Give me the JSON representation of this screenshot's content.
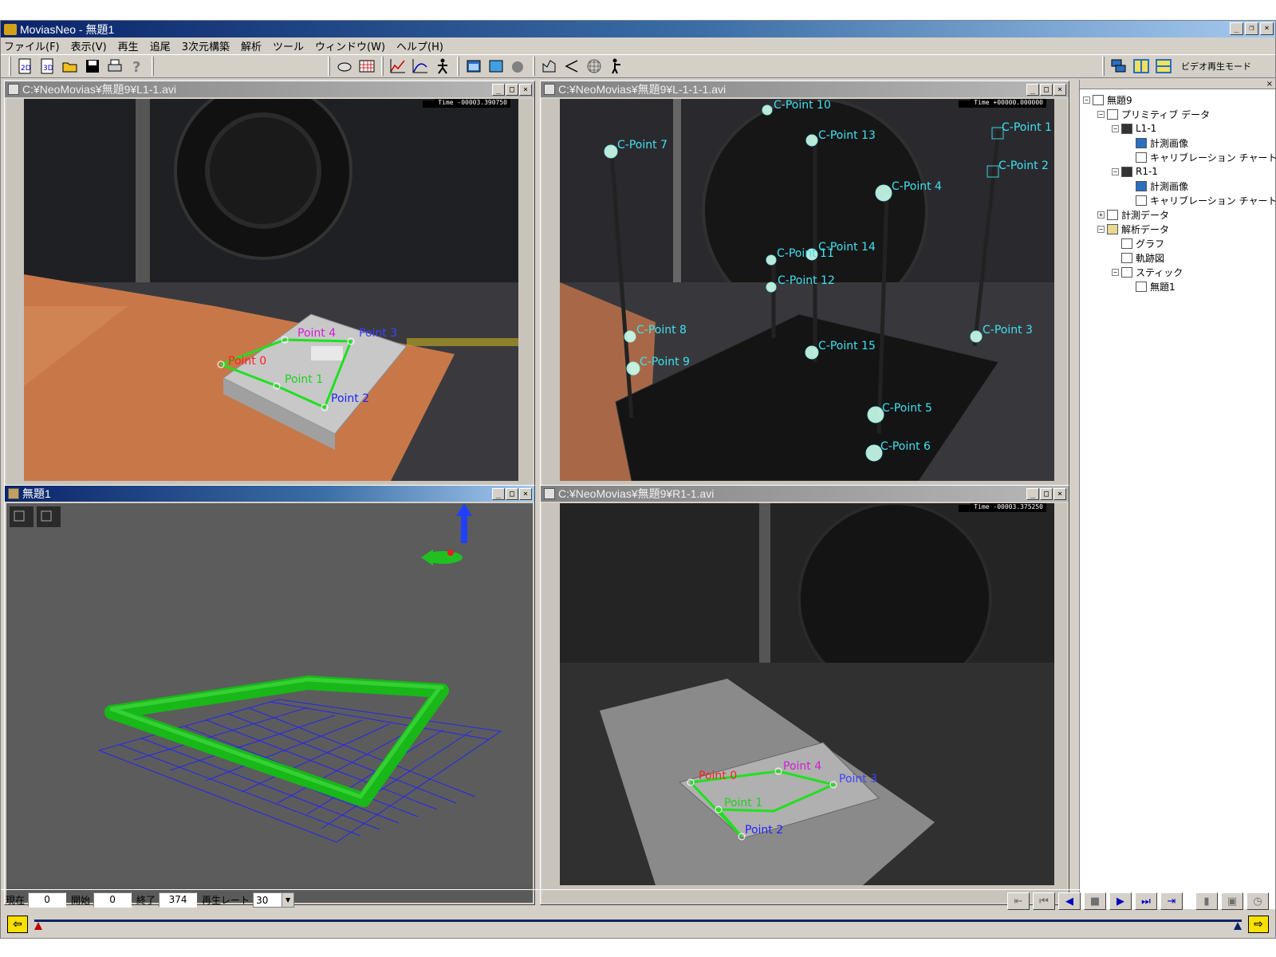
{
  "window": {
    "title": "MoviasNeo - 無題1"
  },
  "menu": [
    "ファイル(F)",
    "表示(V)",
    "再生",
    "追尾",
    "3次元構築",
    "解析",
    "ツール",
    "ウィンドウ(W)",
    "ヘルプ(H)"
  ],
  "toolbar": {
    "mode_label": "ビデオ再生モード",
    "icons": [
      "2d-icon",
      "3d-icon",
      "open-folder-icon",
      "save-icon",
      "print-icon",
      "help-icon",
      "camera-icon",
      "grid-icon",
      "graph-icon",
      "trajectory-icon",
      "stick-figure-icon",
      "window-icon",
      "window-alt-icon",
      "sphere-icon",
      "analysis-icon",
      "link-icon",
      "mesh-icon",
      "person-icon",
      "cascade-icon",
      "tile-vertical-icon",
      "tile-horizontal-icon"
    ]
  },
  "windows": {
    "top_left": {
      "title": "C:¥NeoMovias¥無題9¥L1-1.avi",
      "time": "Time  -00003.390750",
      "points": [
        {
          "label": "Point 0",
          "color": "#ff2020"
        },
        {
          "label": "Point 4",
          "color": "#d020d0"
        },
        {
          "label": "Point 3",
          "color": "#4040ff"
        },
        {
          "label": "Point 1",
          "color": "#20d020"
        },
        {
          "label": "Point 2",
          "color": "#2020ff"
        }
      ]
    },
    "top_right": {
      "title": "C:¥NeoMovias¥無題9¥L-1-1-1.avi",
      "time": "Time  +00000.000000",
      "points": [
        {
          "label": "C-Point 10"
        },
        {
          "label": "C-Point 13"
        },
        {
          "label": "C-Point 7"
        },
        {
          "label": "C-Point 1"
        },
        {
          "label": "C-Point 2"
        },
        {
          "label": "C-Point 4"
        },
        {
          "label": "C-Point 14"
        },
        {
          "label": "C-Point 11"
        },
        {
          "label": "C-Point 12"
        },
        {
          "label": "C-Point 8"
        },
        {
          "label": "C-Point 3"
        },
        {
          "label": "C-Point 15"
        },
        {
          "label": "C-Point 9"
        },
        {
          "label": "C-Point 5"
        },
        {
          "label": "C-Point 6"
        }
      ],
      "label_color": "#40e0f0"
    },
    "bottom_left": {
      "title": "無題1"
    },
    "bottom_right": {
      "title": "C:¥NeoMovias¥無題9¥R1-1.avi",
      "time": "Time  -00003.375250",
      "points": [
        {
          "label": "Point 0",
          "color": "#ff2020"
        },
        {
          "label": "Point 4",
          "color": "#d020d0"
        },
        {
          "label": "Point 3",
          "color": "#4040ff"
        },
        {
          "label": "Point 1",
          "color": "#20d020"
        },
        {
          "label": "Point 2",
          "color": "#2020ff"
        }
      ]
    }
  },
  "tree": {
    "root": "無題9",
    "primitive": "プリミティブ データ",
    "l1": "L1-1",
    "l1_image": "計測画像",
    "l1_chart": "キャリブレーション チャート",
    "r1": "R1-1",
    "r1_image": "計測画像",
    "r1_chart": "キャリブレーション チャート",
    "measure": "計測データ",
    "analysis": "解析データ",
    "graph": "グラフ",
    "trajectory": "軌跡図",
    "stick": "スティック",
    "stick_child": "無題1"
  },
  "playbar": {
    "current_label": "現在",
    "current_value": "0",
    "start_label": "開始",
    "start_value": "0",
    "end_label": "終了",
    "end_value": "374",
    "rate_label": "再生レート",
    "rate_value": "30"
  },
  "colors": {
    "accent": "#0a246a",
    "face": "#d4d0c8",
    "track_green": "#20c020",
    "grid_blue": "#2020ff"
  }
}
